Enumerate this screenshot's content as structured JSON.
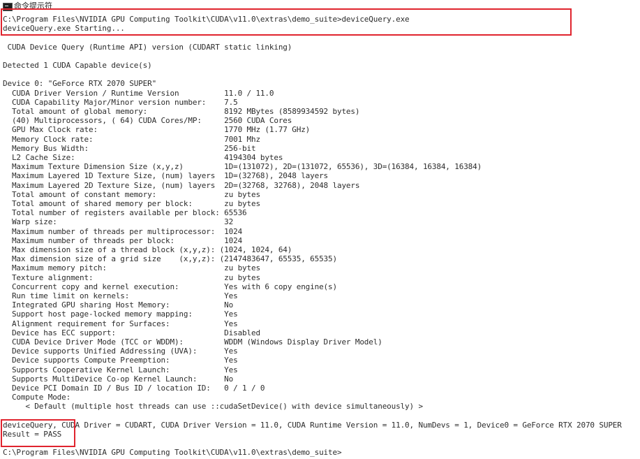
{
  "window": {
    "title": "命令提示符"
  },
  "console": {
    "lines": [
      "C:\\Program Files\\NVIDIA GPU Computing Toolkit\\CUDA\\v11.0\\extras\\demo_suite>deviceQuery.exe",
      "deviceQuery.exe Starting...",
      "",
      " CUDA Device Query (Runtime API) version (CUDART static linking)",
      "",
      "Detected 1 CUDA Capable device(s)",
      "",
      "Device 0: \"GeForce RTX 2070 SUPER\"",
      "  CUDA Driver Version / Runtime Version          11.0 / 11.0",
      "  CUDA Capability Major/Minor version number:    7.5",
      "  Total amount of global memory:                 8192 MBytes (8589934592 bytes)",
      "  (40) Multiprocessors, ( 64) CUDA Cores/MP:     2560 CUDA Cores",
      "  GPU Max Clock rate:                            1770 MHz (1.77 GHz)",
      "  Memory Clock rate:                             7001 Mhz",
      "  Memory Bus Width:                              256-bit",
      "  L2 Cache Size:                                 4194304 bytes",
      "  Maximum Texture Dimension Size (x,y,z)         1D=(131072), 2D=(131072, 65536), 3D=(16384, 16384, 16384)",
      "  Maximum Layered 1D Texture Size, (num) layers  1D=(32768), 2048 layers",
      "  Maximum Layered 2D Texture Size, (num) layers  2D=(32768, 32768), 2048 layers",
      "  Total amount of constant memory:               zu bytes",
      "  Total amount of shared memory per block:       zu bytes",
      "  Total number of registers available per block: 65536",
      "  Warp size:                                     32",
      "  Maximum number of threads per multiprocessor:  1024",
      "  Maximum number of threads per block:           1024",
      "  Max dimension size of a thread block (x,y,z): (1024, 1024, 64)",
      "  Max dimension size of a grid size    (x,y,z): (2147483647, 65535, 65535)",
      "  Maximum memory pitch:                          zu bytes",
      "  Texture alignment:                             zu bytes",
      "  Concurrent copy and kernel execution:          Yes with 6 copy engine(s)",
      "  Run time limit on kernels:                     Yes",
      "  Integrated GPU sharing Host Memory:            No",
      "  Support host page-locked memory mapping:       Yes",
      "  Alignment requirement for Surfaces:            Yes",
      "  Device has ECC support:                        Disabled",
      "  CUDA Device Driver Mode (TCC or WDDM):         WDDM (Windows Display Driver Model)",
      "  Device supports Unified Addressing (UVA):      Yes",
      "  Device supports Compute Preemption:            Yes",
      "  Supports Cooperative Kernel Launch:            Yes",
      "  Supports MultiDevice Co-op Kernel Launch:      No",
      "  Device PCI Domain ID / Bus ID / location ID:   0 / 1 / 0",
      "  Compute Mode:",
      "     < Default (multiple host threads can use ::cudaSetDevice() with device simultaneously) >",
      "",
      "deviceQuery, CUDA Driver = CUDART, CUDA Driver Version = 11.0, CUDA Runtime Version = 11.0, NumDevs = 1, Device0 = GeForce RTX 2070 SUPER",
      "Result = PASS",
      "",
      "C:\\Program Files\\NVIDIA GPU Computing Toolkit\\CUDA\\v11.0\\extras\\demo_suite>"
    ]
  },
  "annotations": {
    "box_color": "#e0242e"
  }
}
